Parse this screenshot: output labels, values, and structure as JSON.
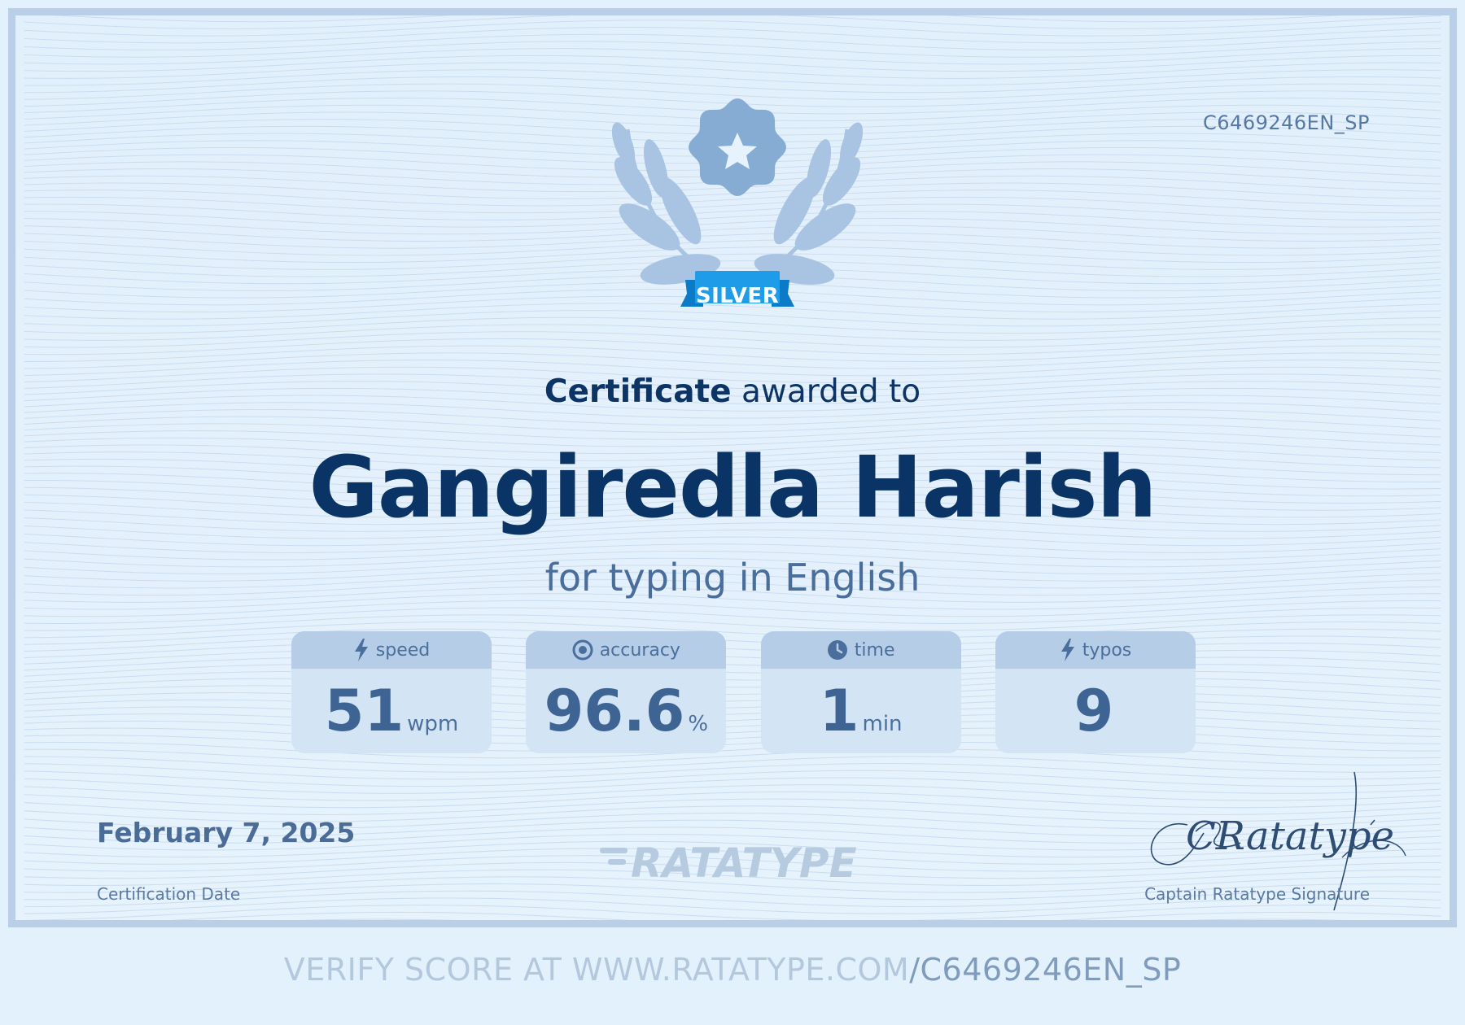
{
  "certificate": {
    "id": "C6469246EN_SP",
    "level": "SILVER",
    "heading_bold": "Certificate",
    "heading_rest": "awarded to",
    "recipient": "Gangiredla Harish",
    "subtitle": "for typing in English"
  },
  "stats": [
    {
      "label": "speed",
      "icon": "lightning-icon",
      "value": "51",
      "unit": "wpm"
    },
    {
      "label": "accuracy",
      "icon": "target-icon",
      "value": "96.6",
      "unit": "%"
    },
    {
      "label": "time",
      "icon": "clock-icon",
      "value": "1",
      "unit": "min"
    },
    {
      "label": "typos",
      "icon": "lightning-icon",
      "value": "9",
      "unit": ""
    }
  ],
  "footer": {
    "date": "February 7, 2025",
    "date_label": "Certification Date",
    "logo_text": "RATATYPE",
    "signature_text": "CRatatype",
    "signature_label": "Captain Ratatype Signature"
  },
  "verify": {
    "prefix": "VERIFY SCORE AT WWW.RATATYPE.COM",
    "suffix": "/C6469246EN_SP"
  },
  "colors": {
    "background": "#e3f1fc",
    "frame_border": "#b8cfe7",
    "navy": "#0b3466",
    "ribbon": "#1e9ce8",
    "badge": "#86acd4",
    "laurel": "#a9c4e2"
  }
}
